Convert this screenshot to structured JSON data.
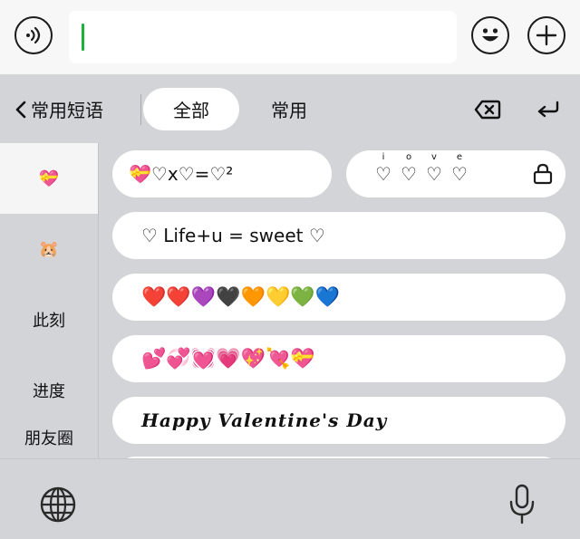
{
  "input_bar": {
    "voice_icon": "voice-input-icon",
    "text_value": "",
    "emoji_icon": "emoji-face-icon",
    "add_icon": "plus-icon"
  },
  "toolbar": {
    "back_label": "常用短语",
    "tab_all": "全部",
    "tab_common": "常用",
    "delete_icon": "backspace-icon",
    "return_icon": "return-icon"
  },
  "sidebar": {
    "items": [
      {
        "label": "💝",
        "active": true
      },
      {
        "label": "🐹",
        "active": false
      },
      {
        "label": "此刻",
        "active": false
      },
      {
        "label": "进度",
        "active": false
      },
      {
        "label": "朋友圈",
        "active": false
      }
    ]
  },
  "phrases": [
    {
      "text": "💝♡x♡=♡²"
    },
    {
      "text": "♡♡♡♡",
      "letters": [
        "i",
        "o",
        "v",
        "e"
      ],
      "locked": true
    },
    {
      "text": "♡ Life+u = sweet ♡"
    },
    {
      "text": "❤️❤️💜🖤🧡💛💚💙"
    },
    {
      "text": "💕💞💓💗💖💘💝"
    },
    {
      "text": "Happy Valentine's Day"
    }
  ],
  "bottom_bar": {
    "globe_icon": "globe-icon",
    "mic_icon": "microphone-icon"
  },
  "colors": {
    "caret": "#19b33a",
    "keyboard_bg": "#d3d4d8",
    "pill_bg": "#ffffff"
  }
}
